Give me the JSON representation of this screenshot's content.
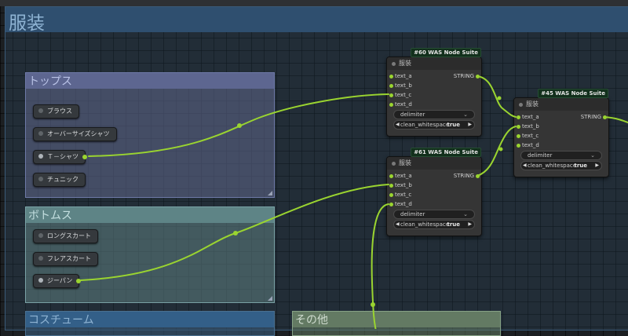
{
  "main_group": {
    "title": "服装"
  },
  "groups": {
    "tops": {
      "title": "トップス",
      "items": [
        "ブラウス",
        "オーバーサイズシャツ",
        "Ｔ－シャツ",
        "チュニック"
      ]
    },
    "bottoms": {
      "title": "ボトムス",
      "items": [
        "ロングスカート",
        "フレアスカート",
        "ジーパン"
      ]
    },
    "costume": {
      "title": "コスチューム"
    },
    "other": {
      "title": "その他"
    }
  },
  "nodes": {
    "n60": {
      "badge": "#60 WAS Node Suite",
      "title": "服装",
      "inputs": [
        "text_a",
        "text_b",
        "text_c",
        "text_d"
      ],
      "output": "STRING",
      "delimiter_label": "delimiter",
      "clean_label": "clean_whitespace",
      "clean_value": "true"
    },
    "n61": {
      "badge": "#61 WAS Node Suite",
      "title": "服装",
      "inputs": [
        "text_a",
        "text_b",
        "text_c",
        "text_d"
      ],
      "output": "STRING",
      "delimiter_label": "delimiter",
      "clean_label": "clean_whitespace",
      "clean_value": "true"
    },
    "n45": {
      "badge": "#45 WAS Node Suite",
      "title": "服装",
      "inputs": [
        "text_a",
        "text_b",
        "text_c",
        "text_d"
      ],
      "output": "STRING",
      "delimiter_label": "delimiter",
      "clean_label": "clean_whitespace",
      "clean_value": "true"
    }
  },
  "colors": {
    "wire": "#9ad430",
    "accent_blue": "#8fb4d4"
  },
  "icons": {
    "chevron": "chevron-down-icon",
    "arrow_left": "arrow-left-icon",
    "arrow_right": "arrow-right-icon"
  }
}
